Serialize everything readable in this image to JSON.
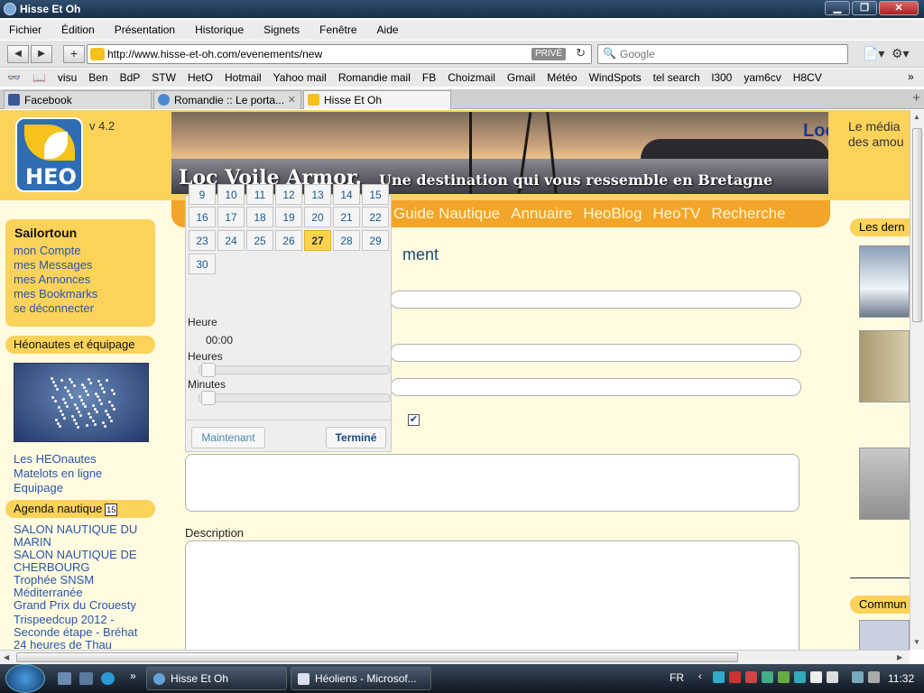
{
  "window": {
    "title": "Hisse Et Oh"
  },
  "menu": [
    "Fichier",
    "Édition",
    "Présentation",
    "Historique",
    "Signets",
    "Fenêtre",
    "Aide"
  ],
  "nav": {
    "url": "http://www.hisse-et-oh.com/evenements/new",
    "private_badge": "PRIVÉ",
    "search_placeholder": "Google"
  },
  "bookmarks": [
    "visu",
    "Ben",
    "BdP",
    "STW",
    "HetO",
    "Hotmail",
    "Yahoo mail",
    "Romandie mail",
    "FB",
    "Choizmail",
    "Gmail",
    "Météo",
    "WindSpots",
    "tel search",
    "l300",
    "yam6cv",
    "H8CV"
  ],
  "tabs": [
    {
      "label": "Facebook",
      "color": "#3b5998"
    },
    {
      "label": "Romandie :: Le porta...",
      "color": "#4a8ad0"
    },
    {
      "label": "Hisse Et Oh",
      "color": "#f5c11a"
    }
  ],
  "site": {
    "logo_text": "HEO",
    "version": "v 4.2",
    "banner_title": "Loc Voile Armor.",
    "banner_subtitle": "Une destination qui vous ressemble en Bretagne",
    "banner_loc": "Loc",
    "right_ad": [
      "Le média",
      "des amou"
    ],
    "menu": [
      "Forums",
      "Articles",
      "Annonces",
      "Guide Nautique",
      "Annuaire",
      "HeoBlog",
      "HeoTV",
      "Recherche"
    ]
  },
  "sidebar": {
    "user": "Sailortoun",
    "user_links": [
      "mon Compte",
      "mes Messages",
      "mes Annonces",
      "mes Bookmarks",
      "se déconnecter"
    ],
    "heonautes_title": "Héonautes et équipage",
    "heonautes_links": [
      "Les HEOnautes",
      "Matelots en ligne",
      "Equipage"
    ],
    "agenda_title": "Agenda nautique",
    "agenda_icon_text": "15",
    "agenda_items": [
      "SALON NAUTIQUE DU MARIN",
      "SALON NAUTIQUE DE CHERBOURG",
      "Trophée SNSM Méditerranée",
      "Grand Prix du Crouesty",
      "Trispeedcup 2012 - Seconde étape - Bréhat",
      "24 heures de Thau"
    ]
  },
  "form": {
    "title_partial": "ment",
    "checkbox_text_partial": "t",
    "checkbox_checked": true,
    "description_label": "Description"
  },
  "right_col": {
    "header1": "Les dern",
    "header2": "Commun"
  },
  "datepicker": {
    "partial_row": [
      "9",
      "10",
      "11",
      "12",
      "13",
      "14",
      "15"
    ],
    "rows": [
      [
        "16",
        "17",
        "18",
        "19",
        "20",
        "21",
        "22"
      ],
      [
        "23",
        "24",
        "25",
        "26",
        "27",
        "28",
        "29"
      ],
      [
        "30"
      ]
    ],
    "selected_day": "27",
    "heure_label": "Heure",
    "time": "00:00",
    "heures_label": "Heures",
    "minutes_label": "Minutes",
    "hours_value": 0,
    "minutes_value": 0,
    "now_button": "Maintenant",
    "done_button": "Terminé"
  },
  "taskbar": {
    "tasks": [
      "Hisse Et Oh",
      "Héoliens - Microsof..."
    ],
    "language": "FR",
    "clock": "11:32"
  }
}
